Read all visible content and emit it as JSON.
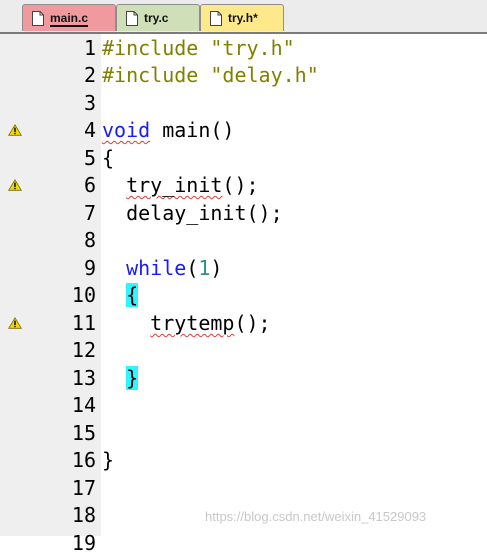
{
  "tabs": [
    {
      "label": "main.c",
      "active": true,
      "color": "#f09aa0"
    },
    {
      "label": "try.c",
      "active": false,
      "color": "#cfe0b8"
    },
    {
      "label": "try.h*",
      "active": false,
      "color": "#fde98c"
    }
  ],
  "editor": {
    "lines": [
      {
        "num": "1",
        "warning": false
      },
      {
        "num": "2",
        "warning": false
      },
      {
        "num": "3",
        "warning": false
      },
      {
        "num": "4",
        "warning": true
      },
      {
        "num": "5",
        "warning": false
      },
      {
        "num": "6",
        "warning": true
      },
      {
        "num": "7",
        "warning": false
      },
      {
        "num": "8",
        "warning": false
      },
      {
        "num": "9",
        "warning": false
      },
      {
        "num": "10",
        "warning": false
      },
      {
        "num": "11",
        "warning": true
      },
      {
        "num": "12",
        "warning": false
      },
      {
        "num": "13",
        "warning": false
      },
      {
        "num": "14",
        "warning": false
      },
      {
        "num": "15",
        "warning": false
      },
      {
        "num": "16",
        "warning": false
      },
      {
        "num": "17",
        "warning": false
      },
      {
        "num": "18",
        "warning": false
      },
      {
        "num": "19",
        "warning": false
      }
    ],
    "code": {
      "l1_directive": "#include",
      "l1_file": "\"try.h\"",
      "l2_directive": "#include",
      "l2_file": "\"delay.h\"",
      "l4_type": "void",
      "l4_rest": " main()",
      "l5": "{",
      "l6_call": "try_init",
      "l6_rest": "();",
      "l7": "delay_init();",
      "l9_kw": "while",
      "l9_open": "(",
      "l9_num": "1",
      "l9_close": ")",
      "l10_brace": "{",
      "l11_call": "trytemp",
      "l11_rest": "();",
      "l13_brace": "}",
      "l16": "}"
    }
  },
  "watermark": "https://blog.csdn.net/weixin_41529093",
  "colors": {
    "preprocessor": "#808000",
    "keyword": "#1a1aff",
    "number": "#2f8f8f",
    "brace_match": "#2ef5ff",
    "gutter": "#efefef"
  }
}
